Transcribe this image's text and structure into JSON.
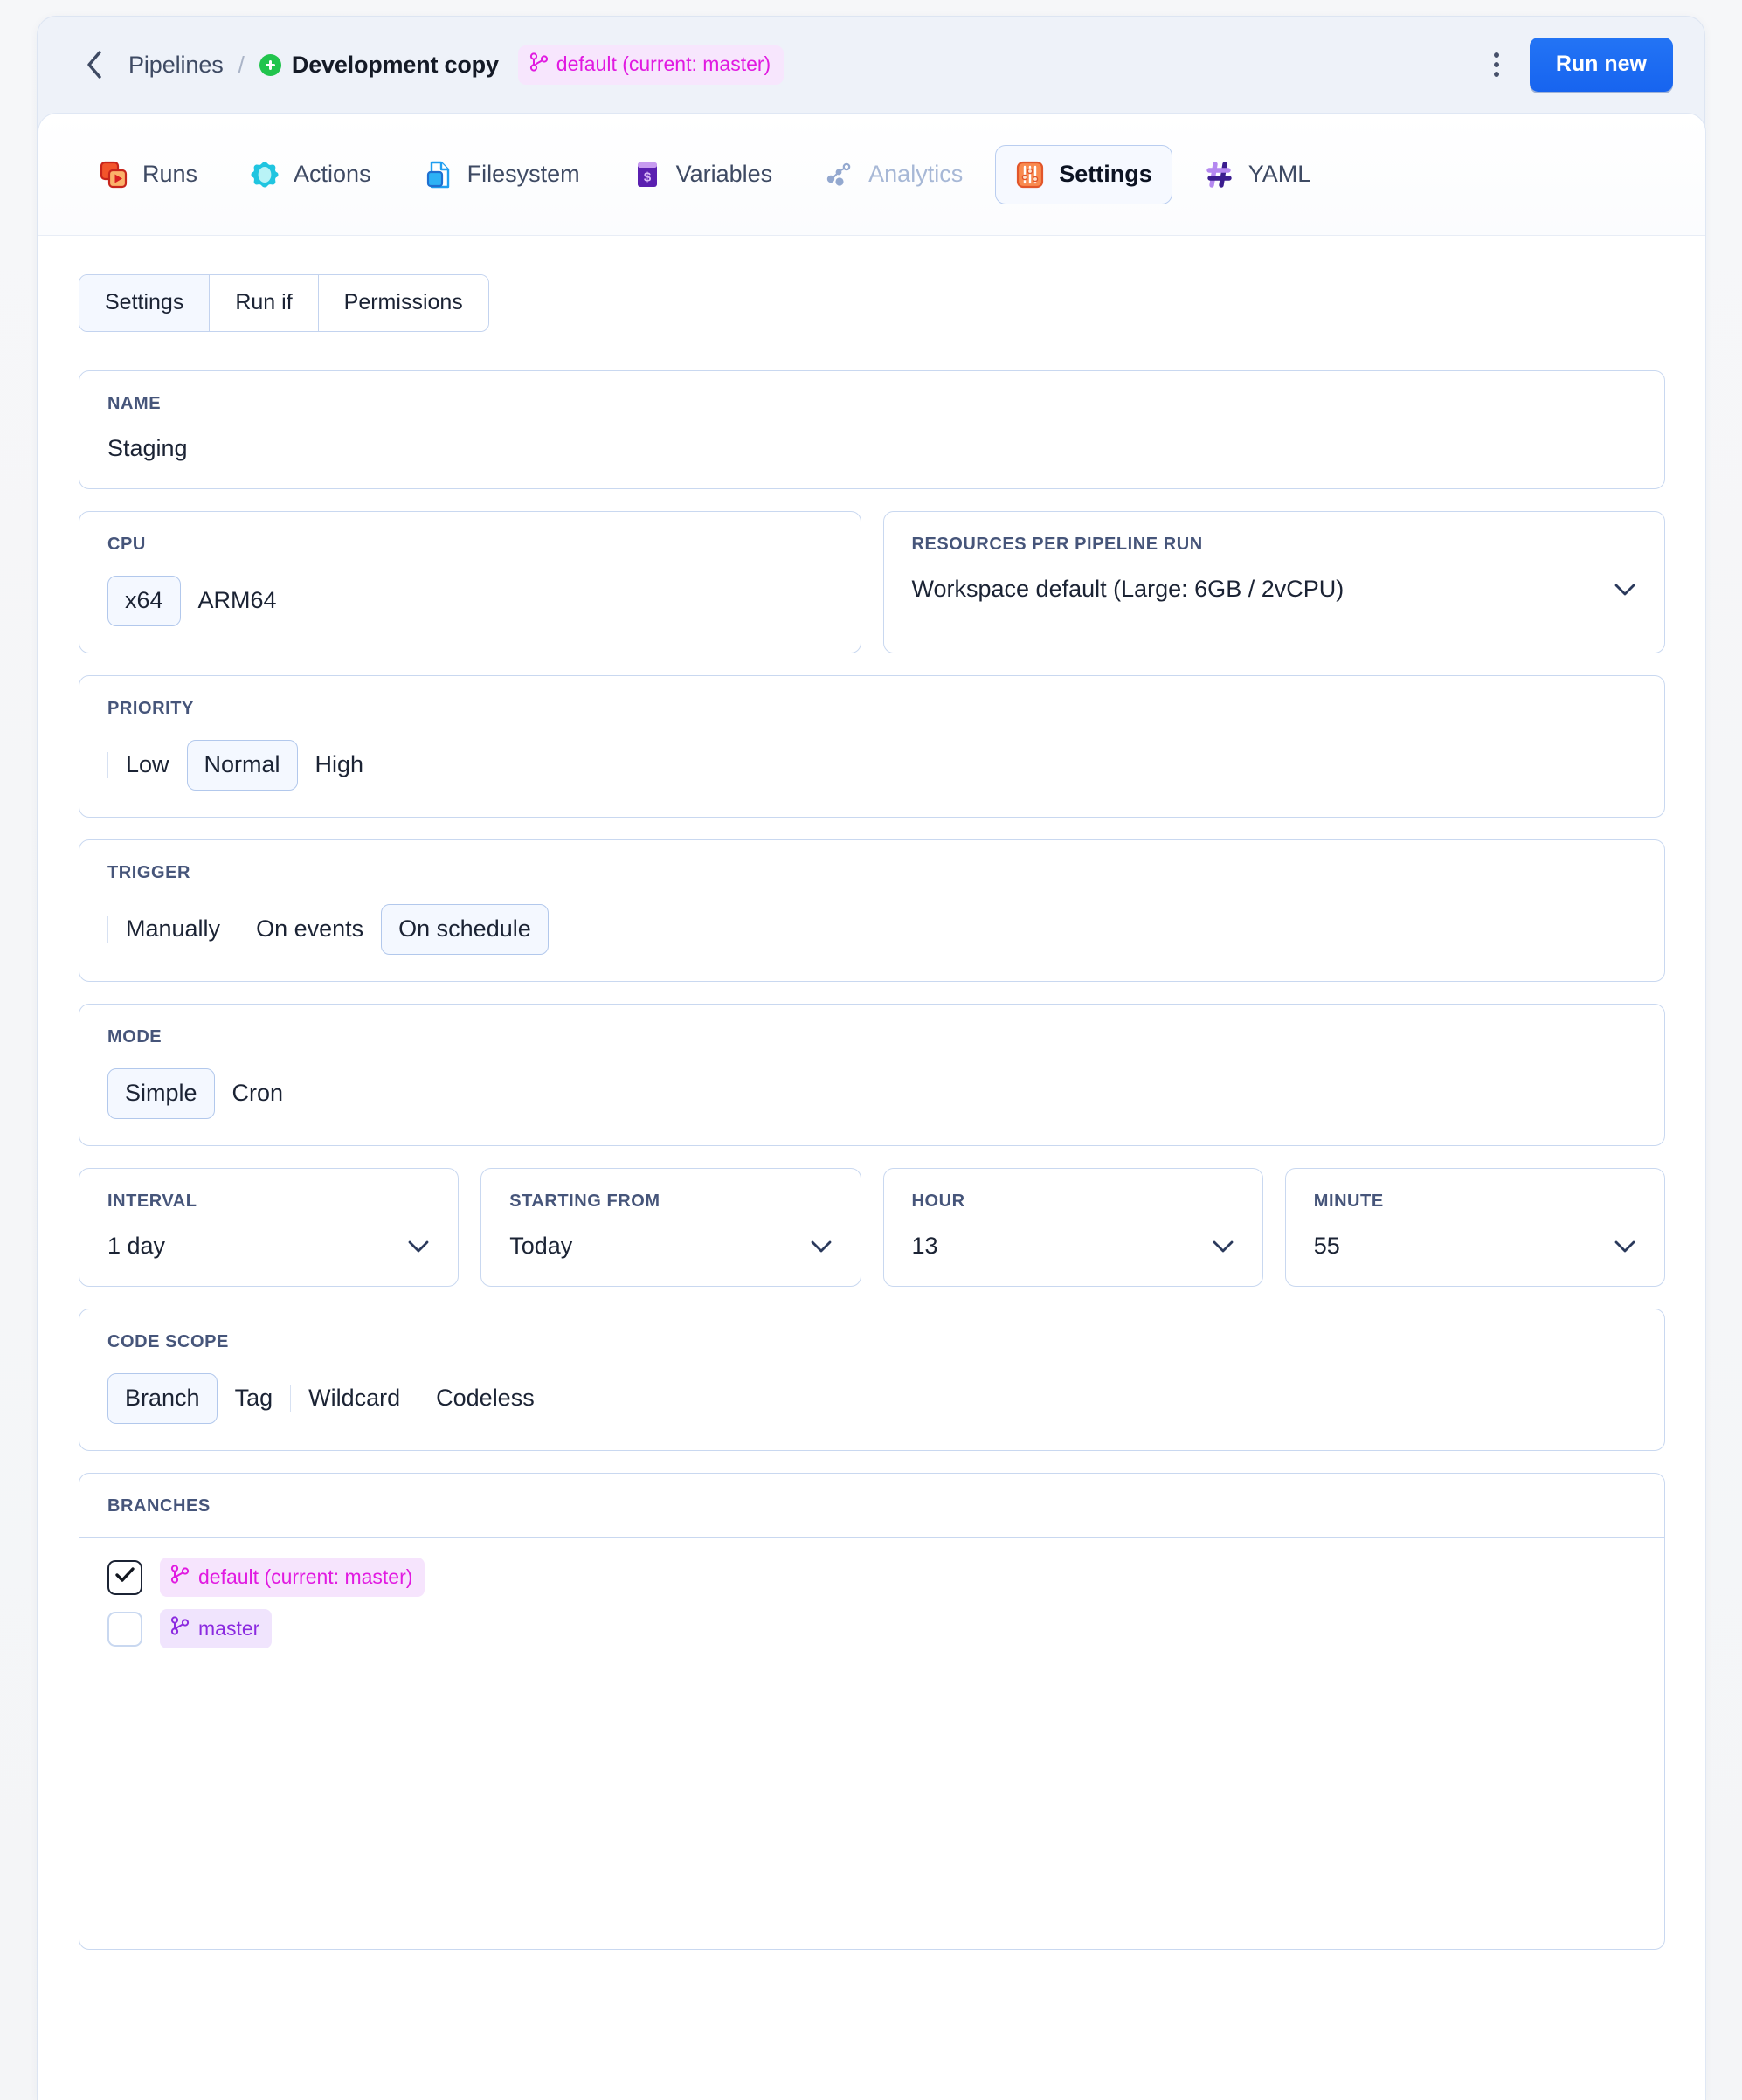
{
  "header": {
    "back_icon": "chevron-left-icon",
    "breadcrumb_root": "Pipelines",
    "breadcrumb_separator": "/",
    "project_name": "Development copy",
    "project_status_icon": "green-check-dot-icon",
    "branch_pill": "default (current: master)",
    "branch_pill_icon": "git-branch-icon",
    "kebab_icon": "more-vertical-icon",
    "run_new_label": "Run new",
    "run_new_color": "#1764ef",
    "branch_pill_color": "#e11ae1"
  },
  "nav_tabs": [
    {
      "label": "Runs",
      "icon": "runs-icon",
      "active": false,
      "disabled": false
    },
    {
      "label": "Actions",
      "icon": "actions-icon",
      "active": false,
      "disabled": false
    },
    {
      "label": "Filesystem",
      "icon": "filesystem-icon",
      "active": false,
      "disabled": false
    },
    {
      "label": "Variables",
      "icon": "variables-icon",
      "active": false,
      "disabled": false
    },
    {
      "label": "Analytics",
      "icon": "analytics-icon",
      "active": false,
      "disabled": true
    },
    {
      "label": "Settings",
      "icon": "settings-icon",
      "active": true,
      "disabled": false
    },
    {
      "label": "YAML",
      "icon": "yaml-icon",
      "active": false,
      "disabled": false
    }
  ],
  "sub_tabs": [
    {
      "label": "Settings",
      "active": true
    },
    {
      "label": "Run if",
      "active": false
    },
    {
      "label": "Permissions",
      "active": false
    }
  ],
  "fields": {
    "name": {
      "label": "NAME",
      "value": "Staging"
    },
    "cpu": {
      "label": "CPU",
      "options": [
        {
          "label": "x64",
          "selected": true
        },
        {
          "label": "ARM64",
          "selected": false
        }
      ]
    },
    "resources": {
      "label": "RESOURCES PER PIPELINE RUN",
      "value": "Workspace default (Large: 6GB / 2vCPU)",
      "chevron_icon": "chevron-down-icon"
    },
    "priority": {
      "label": "PRIORITY",
      "options": [
        {
          "label": "Low",
          "selected": false
        },
        {
          "label": "Normal",
          "selected": true
        },
        {
          "label": "High",
          "selected": false
        }
      ]
    },
    "trigger": {
      "label": "TRIGGER",
      "options": [
        {
          "label": "Manually",
          "selected": false
        },
        {
          "label": "On events",
          "selected": false
        },
        {
          "label": "On schedule",
          "selected": true
        }
      ]
    },
    "mode": {
      "label": "MODE",
      "options": [
        {
          "label": "Simple",
          "selected": true
        },
        {
          "label": "Cron",
          "selected": false
        }
      ]
    },
    "interval": {
      "label": "INTERVAL",
      "value": "1 day",
      "chevron_icon": "chevron-down-icon"
    },
    "starting_from": {
      "label": "STARTING FROM",
      "value": "Today",
      "chevron_icon": "chevron-down-icon"
    },
    "hour": {
      "label": "HOUR",
      "value": "13",
      "chevron_icon": "chevron-down-icon"
    },
    "minute": {
      "label": "MINUTE",
      "value": "55",
      "chevron_icon": "chevron-down-icon"
    },
    "code_scope": {
      "label": "CODE SCOPE",
      "options": [
        {
          "label": "Branch",
          "selected": true
        },
        {
          "label": "Tag",
          "selected": false
        },
        {
          "label": "Wildcard",
          "selected": false
        },
        {
          "label": "Codeless",
          "selected": false
        }
      ]
    },
    "branches": {
      "label": "BRANCHES",
      "items": [
        {
          "label": "default (current: master)",
          "checked": true,
          "color": "magenta",
          "icon": "git-branch-icon"
        },
        {
          "label": "master",
          "checked": false,
          "color": "purple",
          "icon": "git-branch-icon"
        }
      ],
      "check_icon": "check-icon"
    }
  }
}
